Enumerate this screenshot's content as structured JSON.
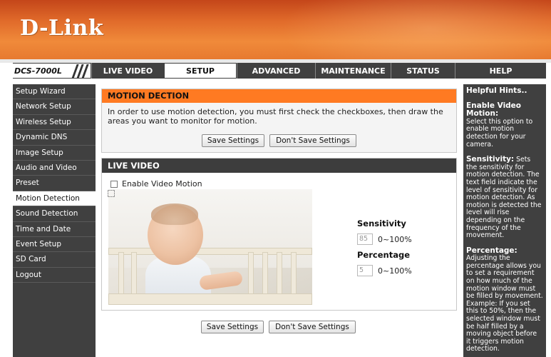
{
  "brand": {
    "logo_text": "D-Link"
  },
  "nav": {
    "model": "DCS-7000L",
    "tabs": [
      {
        "label": "LIVE VIDEO",
        "active": false
      },
      {
        "label": "SETUP",
        "active": true
      },
      {
        "label": "ADVANCED",
        "active": false
      },
      {
        "label": "MAINTENANCE",
        "active": false
      },
      {
        "label": "STATUS",
        "active": false
      },
      {
        "label": "HELP",
        "active": false
      }
    ]
  },
  "sidebar": {
    "items": [
      {
        "label": "Setup Wizard",
        "active": false
      },
      {
        "label": "Network Setup",
        "active": false
      },
      {
        "label": "Wireless Setup",
        "active": false
      },
      {
        "label": "Dynamic DNS",
        "active": false
      },
      {
        "label": "Image Setup",
        "active": false
      },
      {
        "label": "Audio and Video",
        "active": false
      },
      {
        "label": "Preset",
        "active": false
      },
      {
        "label": "Motion Detection",
        "active": true
      },
      {
        "label": "Sound Detection",
        "active": false
      },
      {
        "label": "Time and Date",
        "active": false
      },
      {
        "label": "Event Setup",
        "active": false
      },
      {
        "label": "SD Card",
        "active": false
      },
      {
        "label": "Logout",
        "active": false
      }
    ]
  },
  "motion_section": {
    "title": "MOTION DECTION",
    "description": "In order to use motion detection, you must first check the checkboxes, then draw the areas you want to monitor for motion.",
    "save_label": "Save Settings",
    "dont_save_label": "Don't Save Settings"
  },
  "live_video": {
    "title": "LIVE VIDEO",
    "enable_label": "Enable Video Motion",
    "enable_checked": false,
    "sensitivity_label": "Sensitivity",
    "sensitivity_value": "85",
    "sensitivity_range": "0~100%",
    "percentage_label": "Percentage",
    "percentage_value": "5",
    "percentage_range": "0~100%"
  },
  "bottom_buttons": {
    "save_label": "Save Settings",
    "dont_save_label": "Don't Save Settings"
  },
  "hints": {
    "title": "Helpful Hints..",
    "sections": [
      {
        "head": "Enable Video Motion:",
        "body": "Select this option to enable motion detection for your camera."
      },
      {
        "head": "Sensitivity:",
        "body": "Sets the sensitivity for motion detection. The text field indicate the level of sensitivity for motion detection. As motion is detected the level will rise depending on the frequency of the movement."
      },
      {
        "head": "Percentage:",
        "body": "Adjusting the percentage allows you to set a requirement on how much of the motion window must be filled by movement. Example: If you set this to 50%, then the selected window must be half filled by a moving object before it triggers motion detection."
      }
    ]
  },
  "colors": {
    "brand_orange": "#ff7a22",
    "nav_dark": "#404040"
  }
}
